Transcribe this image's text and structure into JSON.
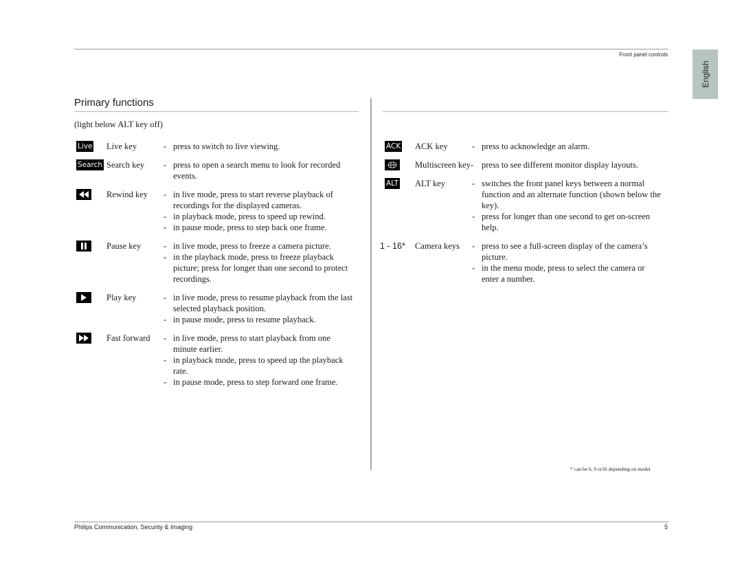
{
  "header": {
    "section_title": "Front panel controls",
    "language_tab": "English"
  },
  "page": {
    "heading": "Primary functions",
    "subtitle": "(light below ALT key off)"
  },
  "left_column": [
    {
      "icon": "live-key-icon",
      "icon_label": "Live",
      "name": "Live key",
      "lines": [
        [
          "-",
          "press to switch to live viewing."
        ]
      ]
    },
    {
      "icon": "search-key-icon",
      "icon_label": "Search",
      "name": "Search key",
      "lines": [
        [
          "-",
          "press to open a search menu to look for recorded"
        ],
        [
          "",
          "events."
        ]
      ]
    },
    {
      "icon": "rewind-icon",
      "icon_label": "",
      "name": "Rewind key",
      "lines": [
        [
          "-",
          "in live mode, press to start reverse playback of"
        ],
        [
          "",
          "recordings for the displayed cameras."
        ],
        [
          "-",
          "in playback mode, press to speed up rewind."
        ],
        [
          "-",
          "in pause mode, press to step back one frame."
        ]
      ]
    },
    {
      "icon": "pause-icon",
      "icon_label": "",
      "name": "Pause key",
      "lines": [
        [
          "-",
          "in live mode, press to freeze a camera picture."
        ],
        [
          "-",
          "in the playback mode, press to freeze playback"
        ],
        [
          "",
          "picture; press for longer than one second to protect"
        ],
        [
          "",
          "recordings."
        ]
      ]
    },
    {
      "icon": "play-icon",
      "icon_label": "",
      "name": "Play key",
      "lines": [
        [
          "-",
          "in live mode, press to resume playback from the last"
        ],
        [
          "",
          "selected playback position."
        ],
        [
          "-",
          "in pause mode, press to resume playback."
        ]
      ]
    },
    {
      "icon": "fast-forward-icon",
      "icon_label": "",
      "name": "Fast forward",
      "lines": [
        [
          "-",
          "in live mode, press to start playback from one"
        ],
        [
          "",
          "minute earlier."
        ],
        [
          "-",
          "in playback mode, press to speed up the playback"
        ],
        [
          "",
          "rate."
        ],
        [
          "-",
          "in pause mode, press to step forward one frame."
        ]
      ]
    }
  ],
  "right_column": [
    {
      "icon": "ack-key-icon",
      "icon_label": "ACK",
      "name": "ACK key",
      "lines": [
        [
          "-",
          "press to acknowledge an alarm."
        ]
      ]
    },
    {
      "icon": "multiscreen-icon",
      "icon_label": "",
      "name": "Multiscreen key-",
      "lines": [
        [
          "",
          "press to see different monitor display layouts."
        ]
      ]
    },
    {
      "icon": "alt-key-icon",
      "icon_label": "ALT",
      "name": "ALT key",
      "lines": [
        [
          "-",
          "switches the front panel keys between a normal"
        ],
        [
          "",
          "function and an alternate function (shown below the"
        ],
        [
          "",
          "key)."
        ],
        [
          "-",
          "press for longer than one second to get on-screen"
        ],
        [
          "",
          "help."
        ]
      ]
    },
    {
      "icon": "camera-keys-label",
      "icon_label": "1 - 16*",
      "name": "Camera keys",
      "lines": [
        [
          "-",
          "press to see a full-screen display of the camera’s"
        ],
        [
          "",
          "picture."
        ],
        [
          "-",
          "in the menu mode, press to select the camera or"
        ],
        [
          "",
          "enter a number."
        ]
      ]
    }
  ],
  "footnote": "* can be 6, 9 or16 depending on model",
  "footer": {
    "company": "Philips Communication, Security & Imaging",
    "page_number": "5"
  }
}
